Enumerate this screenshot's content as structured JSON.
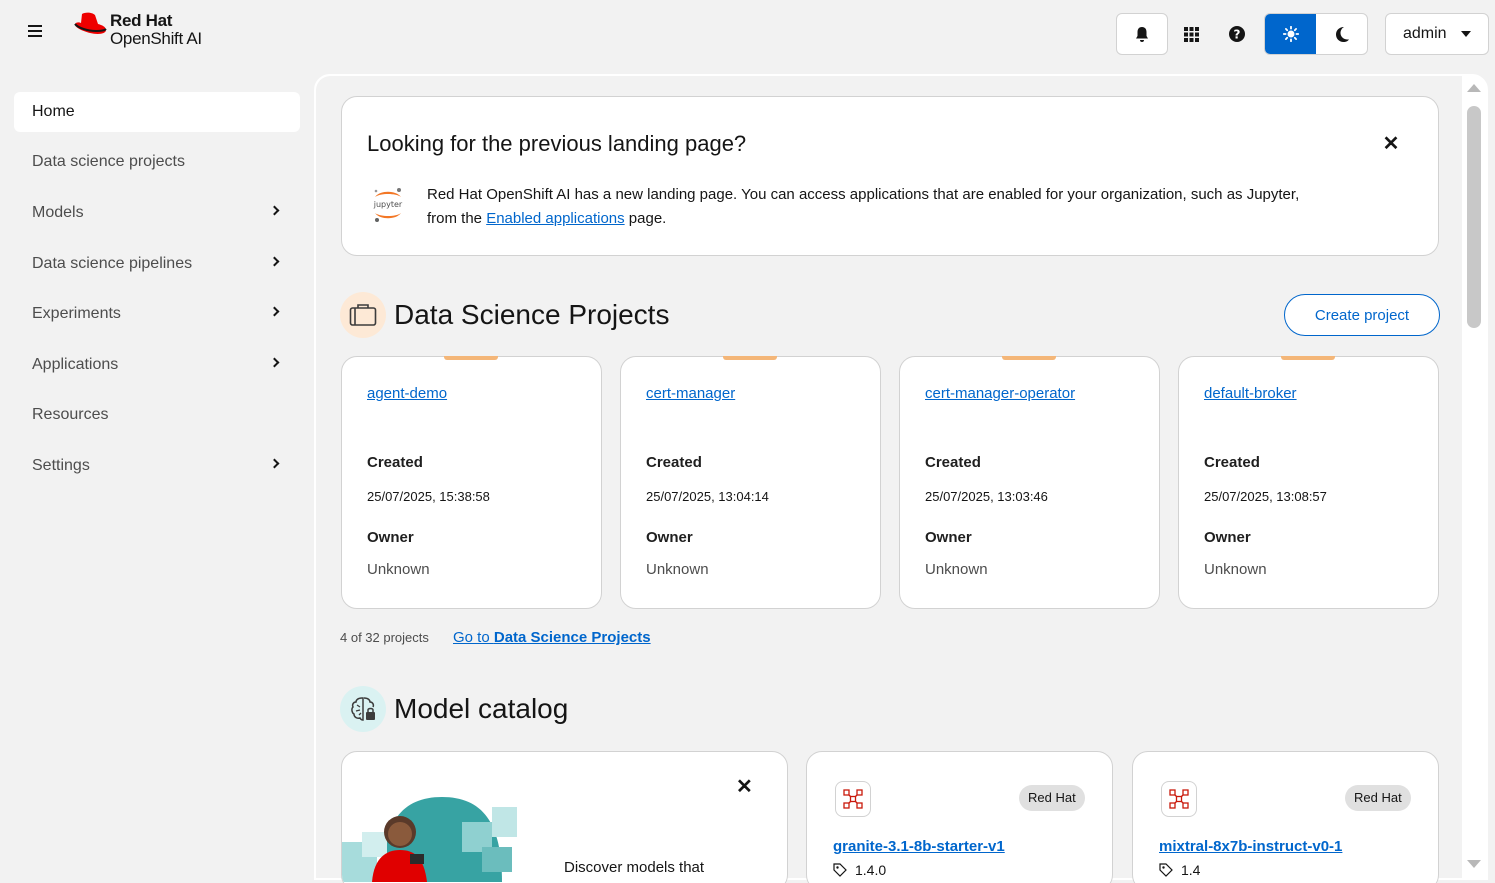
{
  "header": {
    "logo_brand": "Red Hat",
    "logo_product": "OpenShift AI",
    "user": "admin",
    "icons": [
      "bell-icon",
      "apps-grid-icon",
      "help-icon",
      "sun-icon",
      "moon-icon"
    ]
  },
  "sidebar": {
    "items": [
      {
        "label": "Home",
        "active": true,
        "expandable": false
      },
      {
        "label": "Data science projects",
        "expandable": false
      },
      {
        "label": "Models",
        "expandable": true
      },
      {
        "label": "Data science pipelines",
        "expandable": true
      },
      {
        "label": "Experiments",
        "expandable": true
      },
      {
        "label": "Applications",
        "expandable": true
      },
      {
        "label": "Resources",
        "expandable": false
      },
      {
        "label": "Settings",
        "expandable": true
      }
    ]
  },
  "notice": {
    "title": "Looking for the previous landing page?",
    "body_before": "Red Hat OpenShift AI has a new landing page. You can access applications that are enabled for your organization, such as Jupyter, from the ",
    "link": "Enabled applications",
    "body_after": " page.",
    "icon_label": "jupyter"
  },
  "projects": {
    "title": "Data Science Projects",
    "create_label": "Create project",
    "created_label": "Created",
    "owner_label": "Owner",
    "cards": [
      {
        "name": "agent-demo",
        "created": "25/07/2025, 15:38:58",
        "owner": "Unknown"
      },
      {
        "name": "cert-manager",
        "created": "25/07/2025, 13:04:14",
        "owner": "Unknown"
      },
      {
        "name": "cert-manager-operator",
        "created": "25/07/2025, 13:03:46",
        "owner": "Unknown"
      },
      {
        "name": "default-broker",
        "created": "25/07/2025, 13:08:57",
        "owner": "Unknown"
      }
    ],
    "count_text": "4 of 32 projects",
    "goto_prefix": "Go to ",
    "goto_bold": "Data Science Projects"
  },
  "catalog": {
    "title": "Model catalog",
    "promo_text": "Discover models that",
    "models": [
      {
        "name": "granite-3.1-8b-starter-v1",
        "badge": "Red Hat",
        "version": "1.4.0"
      },
      {
        "name": "mixtral-8x7b-instruct-v0-1",
        "badge": "Red Hat",
        "version": "1.4"
      }
    ]
  },
  "colors": {
    "accent": "#0066cc",
    "project_accent": "#f4b678",
    "brand_red": "#ee0000"
  }
}
